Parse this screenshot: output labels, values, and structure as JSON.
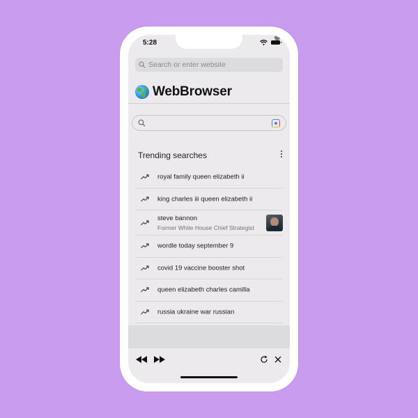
{
  "status_bar": {
    "time": "5:28"
  },
  "url_bar": {
    "placeholder": "Search or enter website"
  },
  "app": {
    "title": "WebBrowser"
  },
  "google": {
    "search_value": ""
  },
  "trending": {
    "header": "Trending searches",
    "items": [
      {
        "label": "royal family queen elizabeth ii"
      },
      {
        "label": "king charles iii queen elizabeth ii"
      },
      {
        "label": "steve bannon",
        "subtitle": "Former White House Chief Strategist"
      },
      {
        "label": "wordle today september 9"
      },
      {
        "label": "covid 19 vaccine booster shot"
      },
      {
        "label": "queen elizabeth charles camilla"
      },
      {
        "label": "russia ukraine war russian"
      }
    ]
  },
  "icons": {
    "url_search": "search-icon",
    "google_search": "search-icon",
    "lens": "google-lens-icon",
    "more": "more-vert-icon",
    "trend": "trending-up-icon",
    "back": "rewind-icon",
    "forward": "fast-forward-icon",
    "reload": "reload-icon",
    "close": "close-icon"
  },
  "colors": {
    "background": "#c99cef",
    "screen": "#eceaec",
    "url_bar": "#dcdbdd",
    "text_primary": "#202124",
    "text_secondary": "#70757a"
  }
}
